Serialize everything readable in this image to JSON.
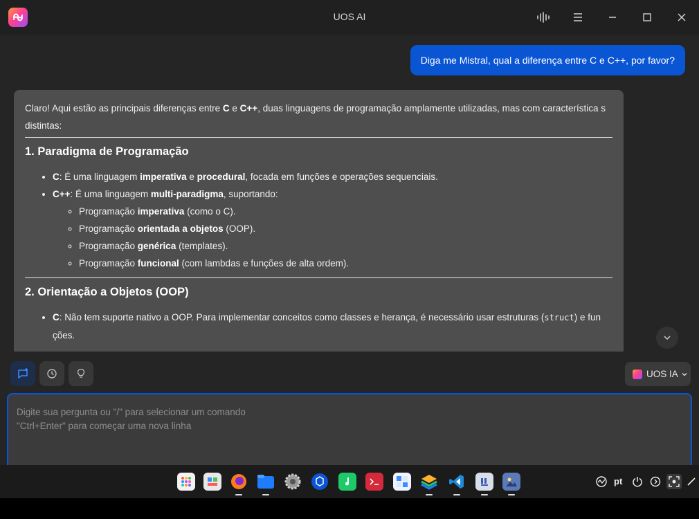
{
  "window": {
    "title": "UOS AI"
  },
  "chat": {
    "user_message": "Diga me Mistral, qual a diferença entre C e C++, por favor?",
    "ai": {
      "intro_pre": "Claro! Aqui estão as principais diferenças entre ",
      "intro_c": "C",
      "intro_and": " e ",
      "intro_cpp": "C++",
      "intro_post": ", duas linguagens de programação amplamente utilizadas, mas com característica s distintas:",
      "section1_title": "1. Paradigma de Programação",
      "s1_c_label": "C",
      "s1_c_pre": ": É uma linguagem ",
      "s1_c_b1": "imperativa",
      "s1_c_mid": " e ",
      "s1_c_b2": "procedural",
      "s1_c_post": ", focada em funções e operações sequenciais.",
      "s1_cpp_label": "C++",
      "s1_cpp_pre": ": É uma linguagem ",
      "s1_cpp_b": "multi-paradigma",
      "s1_cpp_post": ", suportando:",
      "sub": [
        {
          "pre": "Programação ",
          "b": "imperativa",
          "post": " (como o C)."
        },
        {
          "pre": "Programação ",
          "b": "orientada a objetos",
          "post": " (OOP)."
        },
        {
          "pre": "Programação ",
          "b": "genérica",
          "post": " (templates)."
        },
        {
          "pre": "Programação ",
          "b": "funcional",
          "post": " (com lambdas e funções de alta ordem)."
        }
      ],
      "section2_title": "2. Orientação a Objetos (OOP)",
      "s2_c_label": "C",
      "s2_c_pre": ": Não tem suporte nativo a OOP. Para implementar conceitos como classes e herança, é necessário usar estruturas (",
      "s2_c_code": "struct",
      "s2_c_post": ") e fun ções."
    }
  },
  "toolbar": {
    "model_label": "UOS IA"
  },
  "input": {
    "placeholder": "Digite sua pergunta ou \"/\" para selecionar um comando\n\"Ctrl+Enter\" para começar uma nova linha"
  },
  "taskbar": {
    "language": "pt"
  },
  "colors": {
    "accent": "#0a55d4",
    "bubble_ai": "#4e4e4e",
    "background": "#252525"
  },
  "icons": {
    "titlebar": [
      "app-logo-icon",
      "voice-waveform-icon",
      "menu-icon",
      "minimize-icon",
      "maximize-icon",
      "close-icon"
    ],
    "toolbar": [
      "new-chat-icon",
      "history-icon",
      "lightbulb-icon",
      "chevron-down-icon"
    ],
    "dock": [
      "launcher-icon",
      "multitasking-icon",
      "firefox-icon",
      "file-manager-icon",
      "settings-icon",
      "app-store-icon",
      "music-icon",
      "terminal-icon",
      "calculator-icon",
      "layers-app-icon",
      "vscode-icon",
      "editor-icon",
      "image-viewer-icon"
    ],
    "tray": [
      "network-icon",
      "power-icon",
      "notification-arrow-icon",
      "screenshot-icon",
      "pen-icon"
    ]
  }
}
